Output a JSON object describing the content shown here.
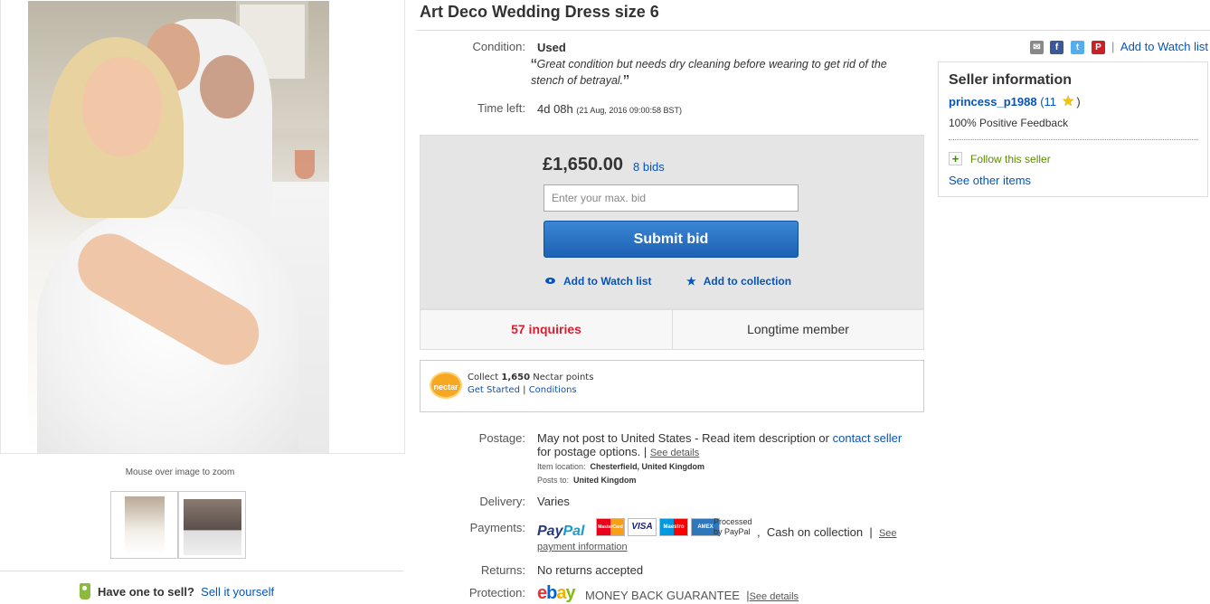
{
  "title": "Art Deco Wedding Dress size 6",
  "gallery": {
    "zoom_hint": "Mouse over image to zoom",
    "sell_prompt": "Have one to sell?",
    "sell_link": "Sell it yourself"
  },
  "condition": {
    "label": "Condition:",
    "value": "Used",
    "quote_open": "“",
    "quote": "Great condition but needs dry cleaning before wearing to get rid of the stench of betrayal.",
    "quote_close": "”"
  },
  "time_left": {
    "label": "Time left:",
    "value": "4d 08h",
    "end": "(21 Aug, 2016   09:00:58 BST)"
  },
  "bid": {
    "price": "£1,650.00",
    "bids": "8 bids",
    "input_placeholder": "Enter your max. bid",
    "submit_label": "Submit bid",
    "watch_label": "Add to Watch list",
    "collection_label": "Add to collection"
  },
  "stats": {
    "inquiries": "57 inquiries",
    "member": "Longtime member"
  },
  "nectar": {
    "logo": "nectar",
    "collect": "Collect",
    "points": "1,650",
    "points_suffix": "Nectar points",
    "get_started": "Get Started",
    "sep": "|",
    "conditions": "Conditions"
  },
  "postage": {
    "label": "Postage:",
    "text_1": "May not post to United States - Read item description or",
    "contact": "contact seller",
    "text_2": "for postage options.",
    "sep": "|",
    "see_details": "See details",
    "location_label": "Item location:",
    "location": "Chesterfield, United Kingdom",
    "posts_label": "Posts to:",
    "posts": "United Kingdom"
  },
  "delivery": {
    "label": "Delivery:",
    "value": "Varies"
  },
  "payments": {
    "label": "Payments:",
    "paypal_a": "Pay",
    "paypal_b": "Pal",
    "cards": [
      "MasterCard",
      "VISA",
      "Maestro",
      "AMEX"
    ],
    "processed_1": "Processed",
    "processed_2": "by PayPal",
    "comma": ",",
    "cash": "Cash on collection",
    "sep": "|",
    "see_1": "See",
    "see_2": "payment information"
  },
  "returns": {
    "label": "Returns:",
    "value": "No returns accepted"
  },
  "protection": {
    "label": "Protection:",
    "logo": [
      "e",
      "b",
      "a",
      "y"
    ],
    "guarantee": "MONEY BACK GUARANTEE",
    "sep": "|",
    "see_details": "See details"
  },
  "share": {
    "icons": [
      "mail-icon",
      "facebook-icon",
      "twitter-icon",
      "pinterest-icon"
    ],
    "fb": "f",
    "tw": "t",
    "pin": "P",
    "mail": "✉"
  },
  "watch_top": {
    "sep": "|",
    "label": "Add to Watch list"
  },
  "seller": {
    "heading": "Seller information",
    "name": "princess_p1988",
    "score_open": "(11",
    "star": "★",
    "score_close": ")",
    "feedback": "100% Positive Feedback",
    "follow_plus": "+",
    "follow": "Follow this seller",
    "other_items": "See other items"
  },
  "colors": {
    "link": "#0654ba",
    "inquiries": "#dd1e31",
    "submit": "#1f62b3"
  }
}
